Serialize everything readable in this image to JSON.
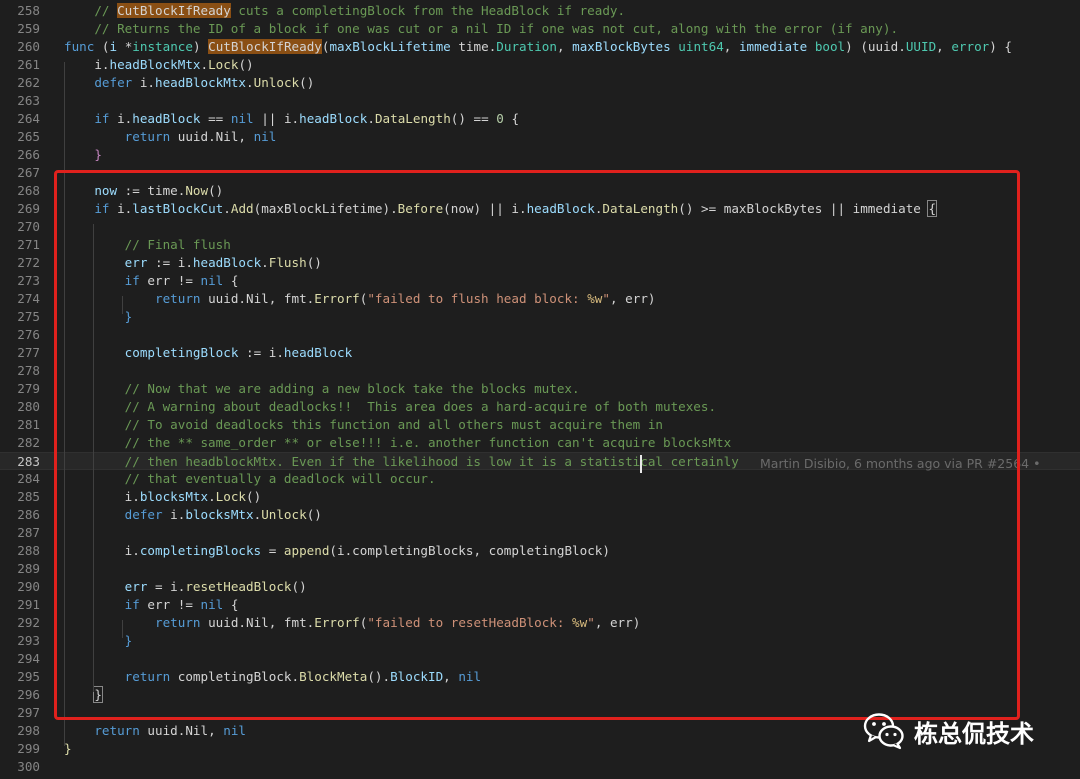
{
  "editor": {
    "current_line": "283",
    "blame_annotation": "Martin Disibio, 6 months ago via PR #2564 •",
    "lines": [
      {
        "num": "258",
        "tokens": [
          {
            "t": "    // ",
            "c": "comment"
          },
          {
            "t": "CutBlockIfReady",
            "c": "highlight"
          },
          {
            "t": " cuts a completingBlock from the HeadBlock if ready.",
            "c": "comment"
          }
        ]
      },
      {
        "num": "259",
        "tokens": [
          {
            "t": "    // Returns the ID of a block if one was cut or a nil ID if one was not cut, along with the error (if any).",
            "c": "comment"
          }
        ]
      },
      {
        "num": "260",
        "tokens": [
          {
            "t": "func",
            "c": "keyword"
          },
          {
            "t": " (",
            "c": "default"
          },
          {
            "t": "i",
            "c": "variable"
          },
          {
            "t": " *",
            "c": "default"
          },
          {
            "t": "instance",
            "c": "type"
          },
          {
            "t": ") ",
            "c": "default"
          },
          {
            "t": "CutBlockIfReady",
            "c": "highlight"
          },
          {
            "t": "(",
            "c": "default"
          },
          {
            "t": "maxBlockLifetime",
            "c": "variable"
          },
          {
            "t": " time.",
            "c": "default"
          },
          {
            "t": "Duration",
            "c": "type"
          },
          {
            "t": ", ",
            "c": "default"
          },
          {
            "t": "maxBlockBytes",
            "c": "variable"
          },
          {
            "t": " ",
            "c": "default"
          },
          {
            "t": "uint64",
            "c": "type"
          },
          {
            "t": ", ",
            "c": "default"
          },
          {
            "t": "immediate",
            "c": "variable"
          },
          {
            "t": " ",
            "c": "default"
          },
          {
            "t": "bool",
            "c": "type"
          },
          {
            "t": ") (uuid.",
            "c": "default"
          },
          {
            "t": "UUID",
            "c": "type"
          },
          {
            "t": ", ",
            "c": "default"
          },
          {
            "t": "error",
            "c": "type"
          },
          {
            "t": ") {",
            "c": "default"
          }
        ]
      },
      {
        "num": "261",
        "tokens": [
          {
            "t": "    i.",
            "c": "default"
          },
          {
            "t": "headBlockMtx",
            "c": "variable"
          },
          {
            "t": ".",
            "c": "default"
          },
          {
            "t": "Lock",
            "c": "function"
          },
          {
            "t": "()",
            "c": "default"
          }
        ]
      },
      {
        "num": "262",
        "tokens": [
          {
            "t": "    ",
            "c": "default"
          },
          {
            "t": "defer",
            "c": "keyword"
          },
          {
            "t": " i.",
            "c": "default"
          },
          {
            "t": "headBlockMtx",
            "c": "variable"
          },
          {
            "t": ".",
            "c": "default"
          },
          {
            "t": "Unlock",
            "c": "function"
          },
          {
            "t": "()",
            "c": "default"
          }
        ]
      },
      {
        "num": "263",
        "tokens": []
      },
      {
        "num": "264",
        "tokens": [
          {
            "t": "    ",
            "c": "default"
          },
          {
            "t": "if",
            "c": "keyword"
          },
          {
            "t": " i.",
            "c": "default"
          },
          {
            "t": "headBlock",
            "c": "variable"
          },
          {
            "t": " == ",
            "c": "default"
          },
          {
            "t": "nil",
            "c": "keyword"
          },
          {
            "t": " || i.",
            "c": "default"
          },
          {
            "t": "headBlock",
            "c": "variable"
          },
          {
            "t": ".",
            "c": "default"
          },
          {
            "t": "DataLength",
            "c": "function"
          },
          {
            "t": "() == ",
            "c": "default"
          },
          {
            "t": "0",
            "c": "number"
          },
          {
            "t": " {",
            "c": "default"
          }
        ]
      },
      {
        "num": "265",
        "tokens": [
          {
            "t": "        ",
            "c": "default"
          },
          {
            "t": "return",
            "c": "keyword"
          },
          {
            "t": " uuid.Nil, ",
            "c": "default"
          },
          {
            "t": "nil",
            "c": "keyword"
          }
        ]
      },
      {
        "num": "266",
        "tokens": [
          {
            "t": "    }",
            "c": "control"
          }
        ]
      },
      {
        "num": "267",
        "tokens": []
      },
      {
        "num": "268",
        "tokens": [
          {
            "t": "    ",
            "c": "default"
          },
          {
            "t": "now",
            "c": "variable"
          },
          {
            "t": " := time.",
            "c": "default"
          },
          {
            "t": "Now",
            "c": "function"
          },
          {
            "t": "()",
            "c": "default"
          }
        ]
      },
      {
        "num": "269",
        "tokens": [
          {
            "t": "    ",
            "c": "default"
          },
          {
            "t": "if",
            "c": "keyword"
          },
          {
            "t": " i.",
            "c": "default"
          },
          {
            "t": "lastBlockCut",
            "c": "variable"
          },
          {
            "t": ".",
            "c": "default"
          },
          {
            "t": "Add",
            "c": "function"
          },
          {
            "t": "(maxBlockLifetime).",
            "c": "default"
          },
          {
            "t": "Before",
            "c": "function"
          },
          {
            "t": "(now) || i.",
            "c": "default"
          },
          {
            "t": "headBlock",
            "c": "variable"
          },
          {
            "t": ".",
            "c": "default"
          },
          {
            "t": "DataLength",
            "c": "function"
          },
          {
            "t": "() >= maxBlockBytes || immediate ",
            "c": "default"
          },
          {
            "t": "{",
            "c": "cursorbrace"
          }
        ]
      },
      {
        "num": "270",
        "tokens": []
      },
      {
        "num": "271",
        "tokens": [
          {
            "t": "        // Final flush",
            "c": "comment"
          }
        ]
      },
      {
        "num": "272",
        "tokens": [
          {
            "t": "        ",
            "c": "default"
          },
          {
            "t": "err",
            "c": "variable"
          },
          {
            "t": " := i.",
            "c": "default"
          },
          {
            "t": "headBlock",
            "c": "variable"
          },
          {
            "t": ".",
            "c": "default"
          },
          {
            "t": "Flush",
            "c": "function"
          },
          {
            "t": "()",
            "c": "default"
          }
        ]
      },
      {
        "num": "273",
        "tokens": [
          {
            "t": "        ",
            "c": "default"
          },
          {
            "t": "if",
            "c": "keyword"
          },
          {
            "t": " err != ",
            "c": "default"
          },
          {
            "t": "nil",
            "c": "keyword"
          },
          {
            "t": " {",
            "c": "default"
          }
        ]
      },
      {
        "num": "274",
        "tokens": [
          {
            "t": "            ",
            "c": "default"
          },
          {
            "t": "return",
            "c": "keyword"
          },
          {
            "t": " uuid.Nil, fmt.",
            "c": "default"
          },
          {
            "t": "Errorf",
            "c": "function"
          },
          {
            "t": "(",
            "c": "default"
          },
          {
            "t": "\"failed to flush head block: ",
            "c": "string"
          },
          {
            "t": "%w",
            "c": "escape"
          },
          {
            "t": "\"",
            "c": "string"
          },
          {
            "t": ", err)",
            "c": "default"
          }
        ]
      },
      {
        "num": "275",
        "tokens": [
          {
            "t": "        }",
            "c": "keyword"
          }
        ]
      },
      {
        "num": "276",
        "tokens": []
      },
      {
        "num": "277",
        "tokens": [
          {
            "t": "        ",
            "c": "default"
          },
          {
            "t": "completingBlock",
            "c": "variable"
          },
          {
            "t": " := i.",
            "c": "default"
          },
          {
            "t": "headBlock",
            "c": "variable"
          }
        ]
      },
      {
        "num": "278",
        "tokens": []
      },
      {
        "num": "279",
        "tokens": [
          {
            "t": "        // Now that we are adding a new block take the blocks mutex.",
            "c": "comment"
          }
        ]
      },
      {
        "num": "280",
        "tokens": [
          {
            "t": "        // A warning about deadlocks!!  This area does a hard-acquire of both mutexes.",
            "c": "comment"
          }
        ]
      },
      {
        "num": "281",
        "tokens": [
          {
            "t": "        // To avoid deadlocks this function and all others must acquire them in",
            "c": "comment"
          }
        ]
      },
      {
        "num": "282",
        "tokens": [
          {
            "t": "        // the ** same_order ** or else!!! i.e. another function can't acquire blocksMtx",
            "c": "comment"
          }
        ]
      },
      {
        "num": "283",
        "tokens": [
          {
            "t": "        // then headblockMtx. Even if the likelihood is low it is a statistical certainly",
            "c": "comment"
          }
        ]
      },
      {
        "num": "284",
        "tokens": [
          {
            "t": "        // that eventually a deadlock will occur.",
            "c": "comment"
          }
        ]
      },
      {
        "num": "285",
        "tokens": [
          {
            "t": "        i.",
            "c": "default"
          },
          {
            "t": "blocksMtx",
            "c": "variable"
          },
          {
            "t": ".",
            "c": "default"
          },
          {
            "t": "Lock",
            "c": "function"
          },
          {
            "t": "()",
            "c": "default"
          }
        ]
      },
      {
        "num": "286",
        "tokens": [
          {
            "t": "        ",
            "c": "default"
          },
          {
            "t": "defer",
            "c": "keyword"
          },
          {
            "t": " i.",
            "c": "default"
          },
          {
            "t": "blocksMtx",
            "c": "variable"
          },
          {
            "t": ".",
            "c": "default"
          },
          {
            "t": "Unlock",
            "c": "function"
          },
          {
            "t": "()",
            "c": "default"
          }
        ]
      },
      {
        "num": "287",
        "tokens": []
      },
      {
        "num": "288",
        "tokens": [
          {
            "t": "        i.",
            "c": "default"
          },
          {
            "t": "completingBlocks",
            "c": "variable"
          },
          {
            "t": " = ",
            "c": "default"
          },
          {
            "t": "append",
            "c": "function"
          },
          {
            "t": "(i.completingBlocks, completingBlock)",
            "c": "default"
          }
        ]
      },
      {
        "num": "289",
        "tokens": []
      },
      {
        "num": "290",
        "tokens": [
          {
            "t": "        ",
            "c": "default"
          },
          {
            "t": "err",
            "c": "variable"
          },
          {
            "t": " = i.",
            "c": "default"
          },
          {
            "t": "resetHeadBlock",
            "c": "function"
          },
          {
            "t": "()",
            "c": "default"
          }
        ]
      },
      {
        "num": "291",
        "tokens": [
          {
            "t": "        ",
            "c": "default"
          },
          {
            "t": "if",
            "c": "keyword"
          },
          {
            "t": " err != ",
            "c": "default"
          },
          {
            "t": "nil",
            "c": "keyword"
          },
          {
            "t": " {",
            "c": "default"
          }
        ]
      },
      {
        "num": "292",
        "tokens": [
          {
            "t": "            ",
            "c": "default"
          },
          {
            "t": "return",
            "c": "keyword"
          },
          {
            "t": " uuid.Nil, fmt.",
            "c": "default"
          },
          {
            "t": "Errorf",
            "c": "function"
          },
          {
            "t": "(",
            "c": "default"
          },
          {
            "t": "\"failed to resetHeadBlock: ",
            "c": "string"
          },
          {
            "t": "%w",
            "c": "escape"
          },
          {
            "t": "\"",
            "c": "string"
          },
          {
            "t": ", err)",
            "c": "default"
          }
        ]
      },
      {
        "num": "293",
        "tokens": [
          {
            "t": "        }",
            "c": "keyword"
          }
        ]
      },
      {
        "num": "294",
        "tokens": []
      },
      {
        "num": "295",
        "tokens": [
          {
            "t": "        ",
            "c": "default"
          },
          {
            "t": "return",
            "c": "keyword"
          },
          {
            "t": " completingBlock.",
            "c": "default"
          },
          {
            "t": "BlockMeta",
            "c": "function"
          },
          {
            "t": "().",
            "c": "default"
          },
          {
            "t": "BlockID",
            "c": "variable"
          },
          {
            "t": ", ",
            "c": "default"
          },
          {
            "t": "nil",
            "c": "keyword"
          }
        ]
      },
      {
        "num": "296",
        "tokens": [
          {
            "t": "    ",
            "c": "default"
          },
          {
            "t": "}",
            "c": "cursorbrace"
          }
        ]
      },
      {
        "num": "297",
        "tokens": []
      },
      {
        "num": "298",
        "tokens": [
          {
            "t": "    ",
            "c": "default"
          },
          {
            "t": "return",
            "c": "keyword"
          },
          {
            "t": " uuid.Nil, ",
            "c": "default"
          },
          {
            "t": "nil",
            "c": "keyword"
          }
        ]
      },
      {
        "num": "299",
        "tokens": [
          {
            "t": "}",
            "c": "function"
          }
        ]
      },
      {
        "num": "300",
        "tokens": []
      }
    ]
  },
  "watermark": {
    "icon": "wechat-icon",
    "text": "栋总侃技术"
  },
  "colors": {
    "background": "#1e1e1e",
    "highlight_box": "#e0211d",
    "comment": "#6a9955",
    "keyword": "#569cd6"
  }
}
